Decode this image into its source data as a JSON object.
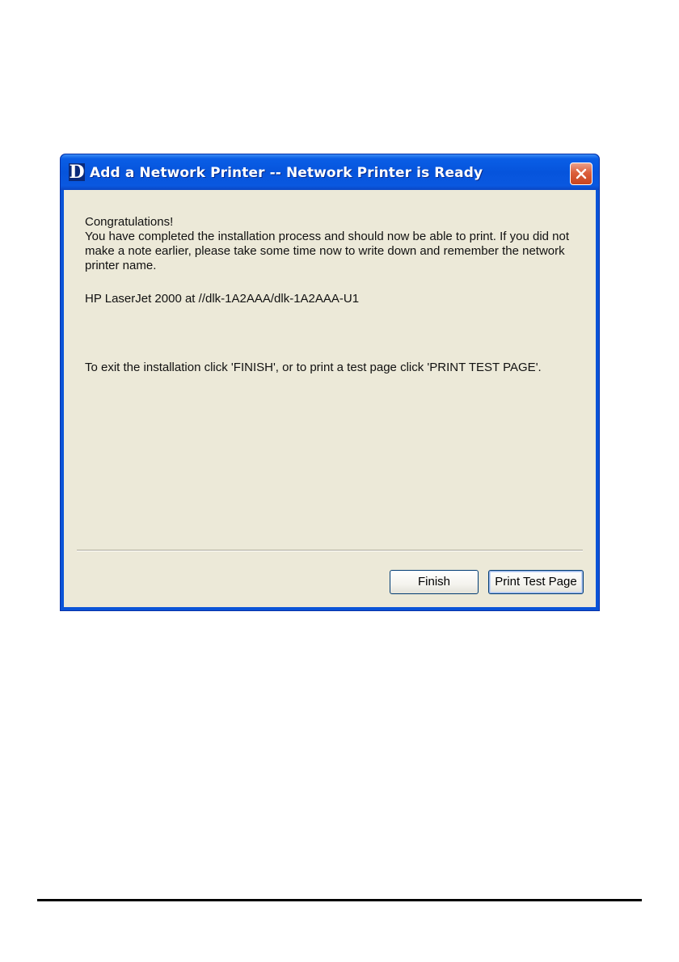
{
  "dialog": {
    "title": "Add a Network Printer -- Network Printer is Ready",
    "app_icon_letter": "D",
    "close_icon": "close-x-icon",
    "congrats": "Congratulations!",
    "body": "You have completed the installation process and should now be able to print. If you did not make a note earlier, please take some time now to write down and remember the network printer name.",
    "printer_name": "HP LaserJet 2000 at //dlk-1A2AAA/dlk-1A2AAA-U1",
    "exit_instructions": "To exit the installation click 'FINISH', or to print a test page click 'PRINT TEST PAGE'.",
    "buttons": {
      "finish": "Finish",
      "print_test_page": "Print Test Page"
    }
  },
  "colors": {
    "titlebar_blue": "#0654dc",
    "client_background": "#ece9d8",
    "close_button_red": "#dc5f3c"
  }
}
